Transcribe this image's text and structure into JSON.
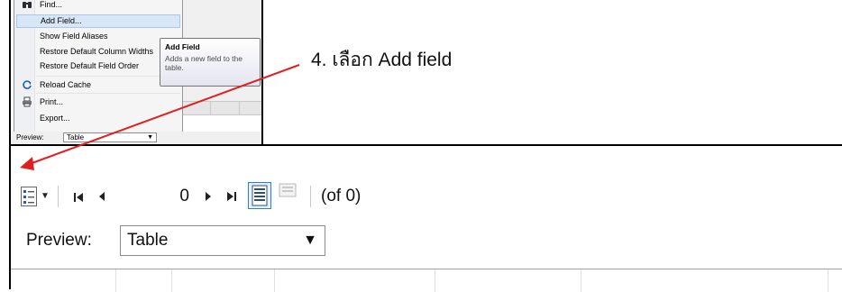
{
  "menu": {
    "items": [
      {
        "label": "Find...",
        "icon": "binoculars-icon"
      },
      {
        "label": "Add Field...",
        "highlighted": true
      },
      {
        "label": "Show Field Aliases"
      },
      {
        "label": "Restore Default Column Widths"
      },
      {
        "label": "Restore Default Field Order"
      },
      {
        "label": "Reload Cache",
        "icon": "refresh-icon"
      },
      {
        "label": "Print...",
        "icon": "printer-icon"
      },
      {
        "label": "Export..."
      }
    ]
  },
  "tooltip": {
    "title": "Add Field",
    "body": "Adds a new field to the table."
  },
  "inset_preview": {
    "label": "Preview:",
    "value": "Table"
  },
  "annotation": {
    "text": "4. เลือก Add field",
    "arrow_color": "#e02020"
  },
  "toolbar": {
    "page_value": "0",
    "of_count": "(of 0)"
  },
  "preview": {
    "label": "Preview:",
    "value": "Table"
  },
  "colors": {
    "menu_highlight": "#d9e6f7",
    "view_button_active": "#2a7de1"
  }
}
